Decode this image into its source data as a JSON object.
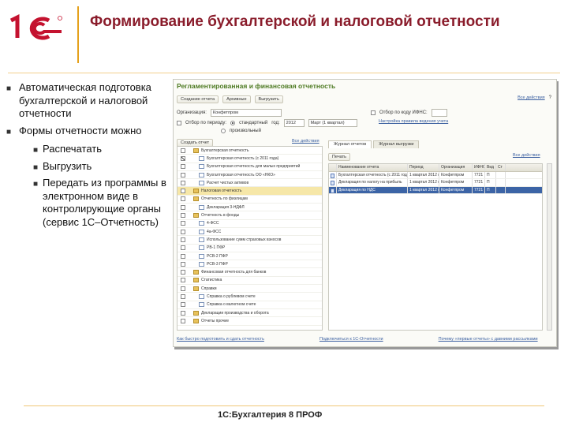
{
  "slide": {
    "title": "Формирование бухгалтерской и налоговой отчетности",
    "footer": "1С:Бухгалтерия 8 ПРОФ"
  },
  "bullets": [
    {
      "text": "Автоматическая подготовка бухгалтерской и налоговой отчетности"
    },
    {
      "text": "Формы отчетности можно"
    }
  ],
  "sub_bullets": [
    {
      "text": "Распечатать"
    },
    {
      "text": "Выгрузить"
    },
    {
      "text": "Передать из программы в электронном виде в контролирующие органы (сервис 1С–Отчетность)"
    }
  ],
  "app": {
    "title": "Регламентированная и финансовая отчетность",
    "toolbar": {
      "create": "Создание отчета",
      "archive": "Архивные",
      "upload": "Выгрузить",
      "all_actions": "Все действия"
    },
    "org_label": "Организация:",
    "org_value": "Конфетпром",
    "period_label": "Отбор по периоду:",
    "period_option": "стандартный",
    "year_label": "год:",
    "year_value": "2012",
    "quarter_value": "Март (1 квартал)",
    "free_option": "произвольный",
    "inn_filter": "Отбор по коду ИФНС:",
    "settings_link": "Настройка правила ведения учета",
    "tab_journal": "Журнал отчетов",
    "tab_uploads": "Журнал выгрузки",
    "left_toolbar": {
      "create": "Создать отчет",
      "all_actions": "Все действия"
    },
    "right_toolbar": {
      "print": "Печать",
      "all_actions": "Все действия"
    },
    "tree": [
      {
        "label": "Бухгалтерская отчетность",
        "type": "folder",
        "checked": false,
        "indent": 1
      },
      {
        "label": "Бухгалтерская отчетность (с 2011 года)",
        "type": "doc",
        "checked": true,
        "indent": 2
      },
      {
        "label": "Бухгалтерская отчетность для малых предприятий",
        "type": "doc",
        "checked": false,
        "indent": 2
      },
      {
        "label": "Бухгалтерская отчетность ОО «НКО»",
        "type": "doc",
        "checked": false,
        "indent": 2
      },
      {
        "label": "Расчет чистых активов",
        "type": "doc",
        "checked": false,
        "indent": 2
      },
      {
        "label": "Налоговая отчетность",
        "type": "folder",
        "checked": false,
        "indent": 1,
        "selected": true
      },
      {
        "label": "Отчетность по физлицам",
        "type": "folder",
        "checked": false,
        "indent": 1
      },
      {
        "label": "Декларация 3-НДФЛ",
        "type": "doc",
        "checked": false,
        "indent": 2
      },
      {
        "label": "Отчетность в фонды",
        "type": "folder",
        "checked": false,
        "indent": 1
      },
      {
        "label": "4-ФСС",
        "type": "doc",
        "checked": false,
        "indent": 2
      },
      {
        "label": "4а-ФСС",
        "type": "doc",
        "checked": false,
        "indent": 2
      },
      {
        "label": "Использование сумм страховых взносов",
        "type": "doc",
        "checked": false,
        "indent": 2
      },
      {
        "label": "РВ-1 ПФР",
        "type": "doc",
        "checked": false,
        "indent": 2
      },
      {
        "label": "РСВ-2 ПФР",
        "type": "doc",
        "checked": false,
        "indent": 2
      },
      {
        "label": "РСВ-3 ПФР",
        "type": "doc",
        "checked": false,
        "indent": 2
      },
      {
        "label": "Финансовая отчетность для банков",
        "type": "folder",
        "checked": false,
        "indent": 1
      },
      {
        "label": "Статистика",
        "type": "folder",
        "checked": false,
        "indent": 1
      },
      {
        "label": "Справки",
        "type": "folder",
        "checked": false,
        "indent": 1
      },
      {
        "label": "Справка о рублевом счете",
        "type": "doc",
        "checked": false,
        "indent": 2
      },
      {
        "label": "Справка о валютном счете",
        "type": "doc",
        "checked": false,
        "indent": 2
      },
      {
        "label": "Декларации производства и оборота",
        "type": "folder",
        "checked": false,
        "indent": 1
      },
      {
        "label": "Отчеты прочие",
        "type": "folder",
        "checked": false,
        "indent": 1
      }
    ],
    "grid_headers": [
      "",
      "Наименование отчета",
      "Период",
      "Организация",
      "ИФНС",
      "Вид",
      "Ст"
    ],
    "grid_rows": [
      {
        "name": "Бухгалтерская отчетность (с 2011 года)",
        "period": "1 квартал 2012 г.",
        "org": "Конфетпром",
        "ifns": "7721",
        "kind": "П",
        "selected": false
      },
      {
        "name": "Декларация по налогу на прибыль",
        "period": "1 квартал 2012 г.",
        "org": "Конфетпром",
        "ifns": "7721",
        "kind": "П",
        "selected": false
      },
      {
        "name": "Декларация по НДС",
        "period": "1 квартал 2012 г.",
        "org": "Конфетпром",
        "ifns": "7721",
        "kind": "П",
        "selected": true
      }
    ],
    "bottom_links": [
      "Как быстро подготовить и сдать отчетность",
      "Подключиться к 1С-Отчетности",
      "Почему «первые отчеты» с давними рассылками"
    ]
  },
  "colors": {
    "title": "#8a1c2b",
    "accent": "#e5a11b",
    "app_title": "#4d7a22",
    "selection": "#3c64a6"
  }
}
